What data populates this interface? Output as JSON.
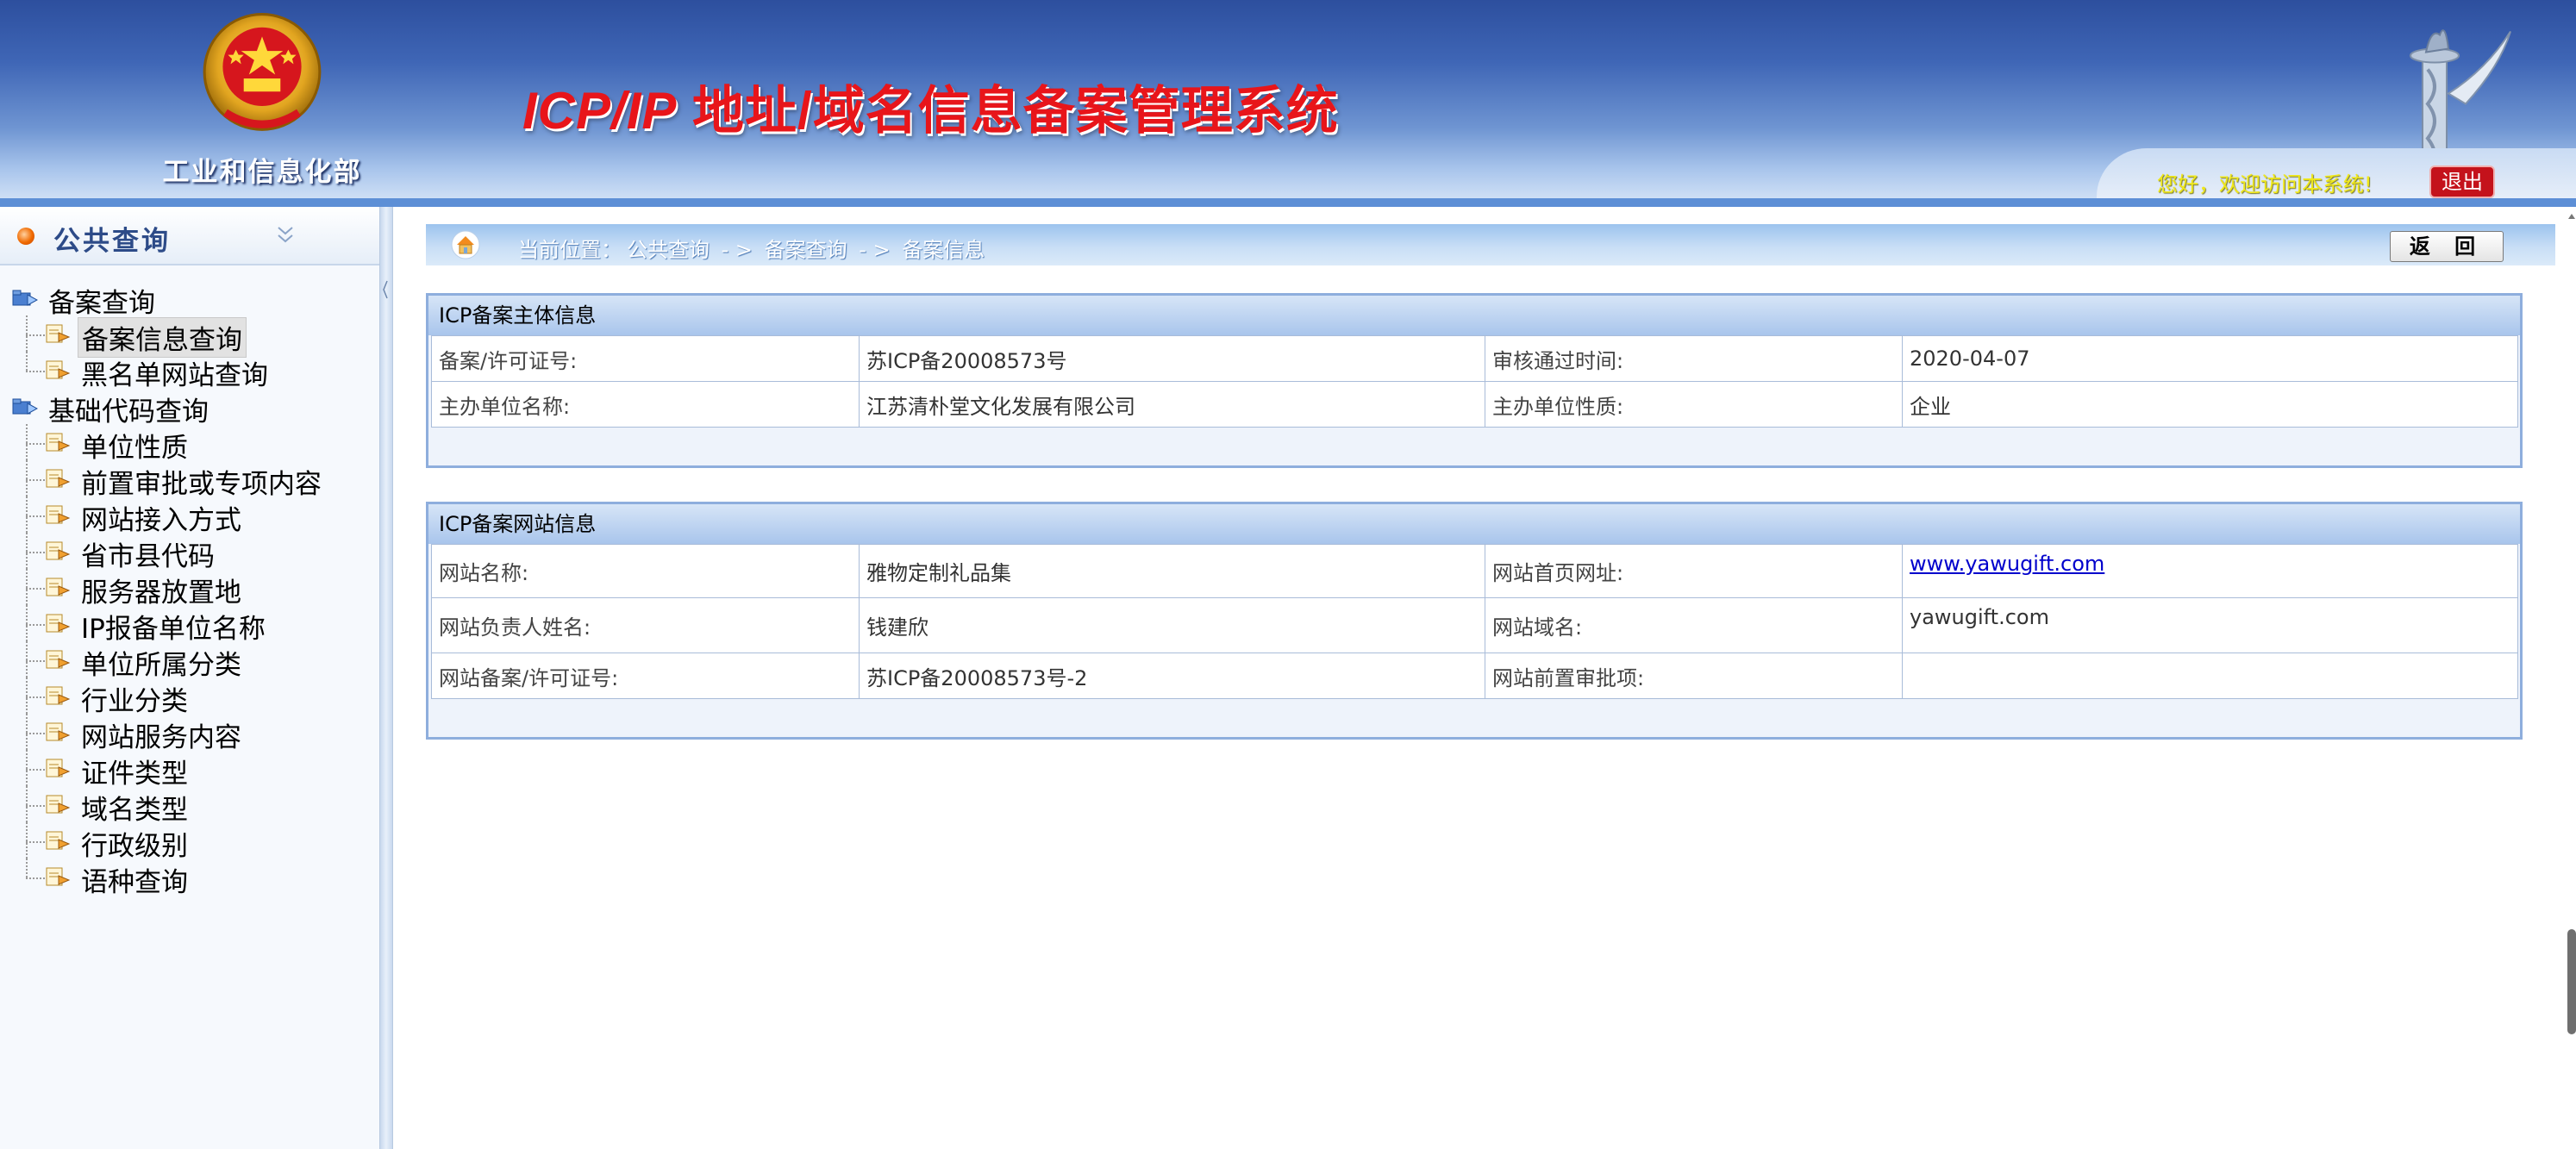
{
  "header": {
    "ministry_name": "工业和信息化部",
    "system_title_latin": "ICP/IP",
    "system_title_cn": " 地址/域名信息备案管理系统",
    "welcome_text": "您好，欢迎访问本系统!",
    "logout_label": "退出"
  },
  "sidebar": {
    "title": "公共查询",
    "items": [
      {
        "label": "备案查询",
        "level": "top"
      },
      {
        "label": "备案信息查询",
        "level": "child",
        "selected": true
      },
      {
        "label": "黑名单网站查询",
        "level": "child"
      },
      {
        "label": "基础代码查询",
        "level": "top"
      },
      {
        "label": "单位性质",
        "level": "child"
      },
      {
        "label": "前置审批或专项内容",
        "level": "child"
      },
      {
        "label": "网站接入方式",
        "level": "child"
      },
      {
        "label": "省市县代码",
        "level": "child"
      },
      {
        "label": "服务器放置地",
        "level": "child"
      },
      {
        "label": "IP报备单位名称",
        "level": "child"
      },
      {
        "label": "单位所属分类",
        "level": "child"
      },
      {
        "label": "行业分类",
        "level": "child"
      },
      {
        "label": "网站服务内容",
        "level": "child"
      },
      {
        "label": "证件类型",
        "level": "child"
      },
      {
        "label": "域名类型",
        "level": "child"
      },
      {
        "label": "行政级别",
        "level": "child"
      },
      {
        "label": "语种查询",
        "level": "child"
      }
    ]
  },
  "breadcrumb": {
    "prefix": "当前位置：",
    "levels": [
      "公共查询",
      "备案查询",
      "备案信息"
    ],
    "separator": " - > "
  },
  "back_label": "返  回",
  "subject_panel": {
    "title": "ICP备案主体信息",
    "rows": [
      {
        "label1": "备案/许可证号:",
        "value1": "苏ICP备20008573号",
        "label2": "审核通过时间:",
        "value2": "2020-04-07"
      },
      {
        "label1": "主办单位名称:",
        "value1": "江苏清朴堂文化发展有限公司",
        "label2": "主办单位性质:",
        "value2": "企业"
      }
    ]
  },
  "website_panel": {
    "title": "ICP备案网站信息",
    "rows": [
      {
        "label1": "网站名称:",
        "value1": "雅物定制礼品集",
        "label2": "网站首页网址:",
        "value2": "www.yawugift.com"
      },
      {
        "label1": "网站负责人姓名:",
        "value1": "钱建欣",
        "label2": "网站域名:",
        "value2": "yawugift.com"
      },
      {
        "label1": "网站备案/许可证号:",
        "value1": "苏ICP备20008573号-2",
        "label2": "网站前置审批项:",
        "value2": ""
      }
    ]
  },
  "colors": {
    "header_top": "#2d4f9e",
    "title_red": "#e8151a",
    "welcome_yellow": "#f0e81a",
    "logout_red": "#c4121b",
    "panel_border": "#8eaedd",
    "link_blue": "#0000cc"
  },
  "icons": {
    "emblem": "national-emblem-icon",
    "pillar": "huabiao-pillar-icon",
    "home": "home-icon",
    "collapse": "chevron-double-down-icon",
    "folder": "folder-arrow-icon",
    "page": "page-arrow-icon"
  }
}
